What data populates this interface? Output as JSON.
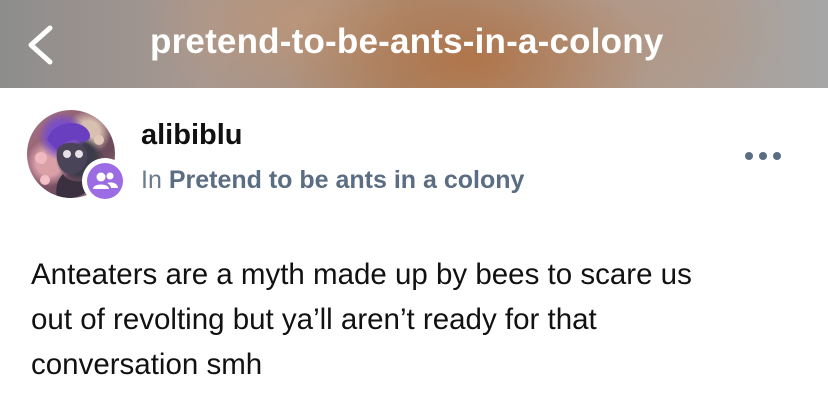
{
  "header": {
    "title": "pretend-to-be-ants-in-a-colony"
  },
  "post": {
    "author": "alibiblu",
    "community_prefix": "In",
    "community_name": "Pretend to be ants in a colony",
    "body": "Anteaters are a myth made up by bees to scare us\nout of revolting but ya’ll aren’t ready for that\nconversation smh"
  },
  "icons": {
    "back": "chevron-left-icon",
    "community": "people-icon",
    "more": "more-horizontal-icon"
  },
  "colors": {
    "community_badge": "#9b6ce3",
    "community_text": "#6b7a8c",
    "body_text": "#111111"
  }
}
